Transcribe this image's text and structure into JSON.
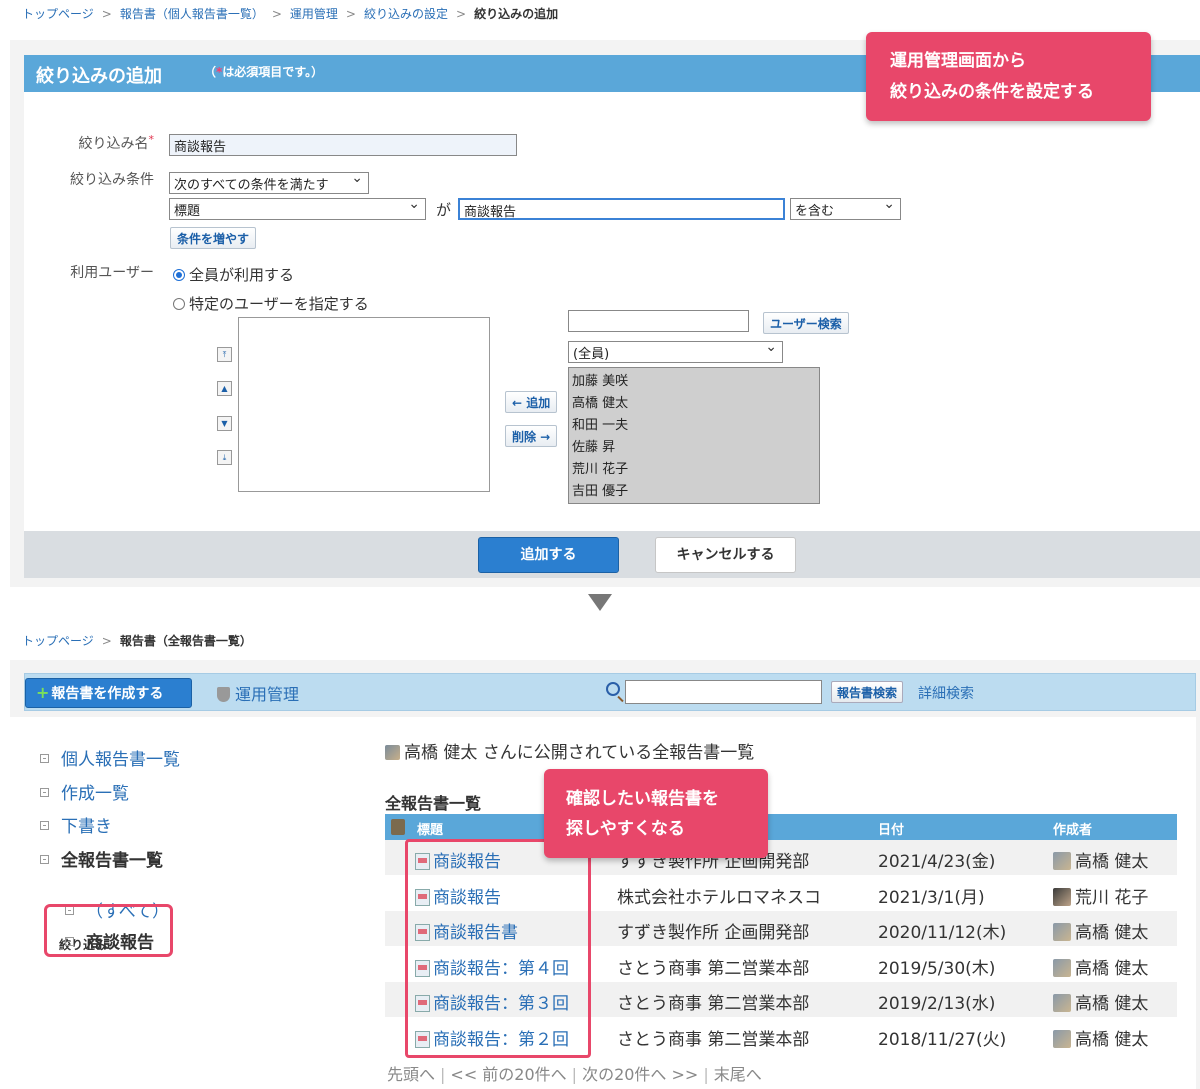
{
  "breadcrumb_top": [
    "トップページ",
    "報告書（個人報告書一覧）",
    "運用管理",
    "絞り込みの設定",
    "絞り込みの追加"
  ],
  "breadcrumb_bottom": [
    "トップページ",
    "報告書（全報告書一覧）"
  ],
  "form": {
    "title": "絞り込みの追加",
    "required_note_prefix": "（",
    "required_note_star": "*",
    "required_note_text": "は必須項目です。）",
    "name_label": "絞り込み名",
    "name_value": "商談報告",
    "condition_label": "絞り込み条件",
    "condition_mode": "次のすべての条件を満たす",
    "condition_field": "標題",
    "condition_ga": "が",
    "condition_value": "商談報告",
    "condition_op": "を含む",
    "add_condition_button": "条件を増やす",
    "users_label": "利用ユーザー",
    "radio_all": "全員が利用する",
    "radio_specific": "特定のユーザーを指定する",
    "user_search_button": "ユーザー検索",
    "group_select": "(全員)",
    "add_button": "← 追加",
    "remove_button": "削除 →",
    "candidates": [
      "加藤 美咲",
      "高橋 健太",
      "和田 一夫",
      "佐藤 昇",
      "荒川 花子",
      "吉田 優子"
    ],
    "submit_button": "追加する",
    "cancel_button": "キャンセルする"
  },
  "callout_top": [
    "運用管理画面から",
    "絞り込みの条件を設定する"
  ],
  "callout_bottom": [
    "確認したい報告書を",
    "探しやすくなる"
  ],
  "toolbar": {
    "create_button": "報告書を作成する",
    "admin_link": "運用管理",
    "search_button": "報告書検索",
    "advanced_search": "詳細検索"
  },
  "sidebar": {
    "items": [
      "個人報告書一覧",
      "作成一覧",
      "下書き",
      "全報告書一覧"
    ],
    "filter_label": "絞り込み",
    "filters": [
      "（すべて）",
      "商談報告"
    ]
  },
  "main": {
    "heading": "高橋 健太 さんに公開されている全報告書一覧",
    "table_title": "全報告書一覧",
    "columns": [
      "標題",
      "日付",
      "作成者"
    ],
    "rows": [
      {
        "title": "商談報告",
        "dept": "すずき製作所 企画開発部",
        "date": "2021/4/23(金)",
        "author": "高橋 健太"
      },
      {
        "title": "商談報告",
        "dept": "株式会社ホテルロマネスコ",
        "date": "2021/3/1(月)",
        "author": "荒川 花子"
      },
      {
        "title": "商談報告書",
        "dept": "すずき製作所 企画開発部",
        "date": "2020/11/12(木)",
        "author": "高橋 健太"
      },
      {
        "title": "商談報告：第４回",
        "dept": "さとう商事 第二営業本部",
        "date": "2019/5/30(木)",
        "author": "高橋 健太"
      },
      {
        "title": "商談報告：第３回",
        "dept": "さとう商事 第二営業本部",
        "date": "2019/2/13(水)",
        "author": "高橋 健太"
      },
      {
        "title": "商談報告：第２回",
        "dept": "さとう商事 第二営業本部",
        "date": "2018/11/27(火)",
        "author": "高橋 健太"
      }
    ],
    "pager": [
      "先頭へ",
      "<< 前の20件へ",
      "次の20件へ >>",
      "末尾へ"
    ]
  },
  "colors": {
    "header_blue": "#5aa7d9",
    "button_blue": "#2b7fd0",
    "callout_pink": "#e8476a"
  }
}
